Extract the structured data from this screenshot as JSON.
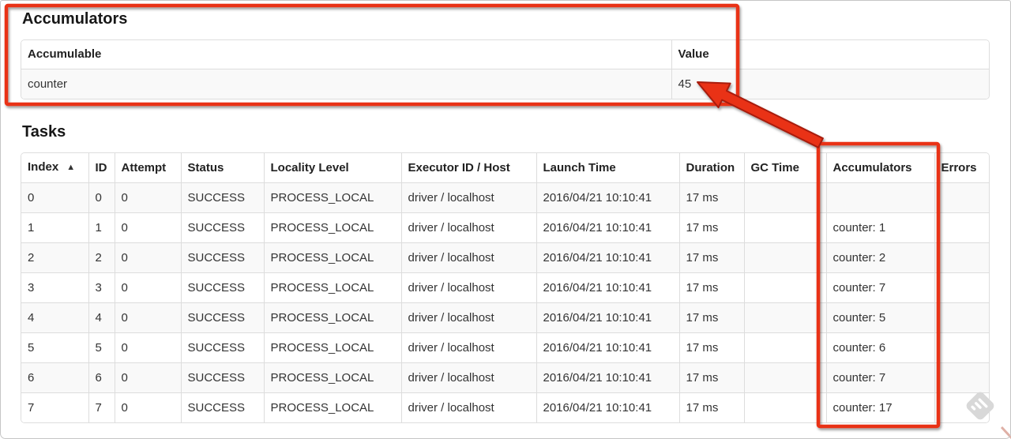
{
  "accumulators_section": {
    "title": "Accumulators",
    "columns": [
      "Accumulable",
      "Value"
    ],
    "rows": [
      {
        "accumulable": "counter",
        "value": "45"
      }
    ]
  },
  "tasks_section": {
    "title": "Tasks",
    "sort_icon": "▲",
    "sorted_column": "Index",
    "columns": [
      "Index",
      "ID",
      "Attempt",
      "Status",
      "Locality Level",
      "Executor ID / Host",
      "Launch Time",
      "Duration",
      "GC Time",
      "Accumulators",
      "Errors"
    ],
    "rows": [
      {
        "index": "0",
        "id": "0",
        "attempt": "0",
        "status": "SUCCESS",
        "locality_level": "PROCESS_LOCAL",
        "executor_id_host": "driver / localhost",
        "launch_time": "2016/04/21 10:10:41",
        "duration": "17 ms",
        "gc_time": "",
        "accumulators": "",
        "errors": ""
      },
      {
        "index": "1",
        "id": "1",
        "attempt": "0",
        "status": "SUCCESS",
        "locality_level": "PROCESS_LOCAL",
        "executor_id_host": "driver / localhost",
        "launch_time": "2016/04/21 10:10:41",
        "duration": "17 ms",
        "gc_time": "",
        "accumulators": "counter: 1",
        "errors": ""
      },
      {
        "index": "2",
        "id": "2",
        "attempt": "0",
        "status": "SUCCESS",
        "locality_level": "PROCESS_LOCAL",
        "executor_id_host": "driver / localhost",
        "launch_time": "2016/04/21 10:10:41",
        "duration": "17 ms",
        "gc_time": "",
        "accumulators": "counter: 2",
        "errors": ""
      },
      {
        "index": "3",
        "id": "3",
        "attempt": "0",
        "status": "SUCCESS",
        "locality_level": "PROCESS_LOCAL",
        "executor_id_host": "driver / localhost",
        "launch_time": "2016/04/21 10:10:41",
        "duration": "17 ms",
        "gc_time": "",
        "accumulators": "counter: 7",
        "errors": ""
      },
      {
        "index": "4",
        "id": "4",
        "attempt": "0",
        "status": "SUCCESS",
        "locality_level": "PROCESS_LOCAL",
        "executor_id_host": "driver / localhost",
        "launch_time": "2016/04/21 10:10:41",
        "duration": "17 ms",
        "gc_time": "",
        "accumulators": "counter: 5",
        "errors": ""
      },
      {
        "index": "5",
        "id": "5",
        "attempt": "0",
        "status": "SUCCESS",
        "locality_level": "PROCESS_LOCAL",
        "executor_id_host": "driver / localhost",
        "launch_time": "2016/04/21 10:10:41",
        "duration": "17 ms",
        "gc_time": "",
        "accumulators": "counter: 6",
        "errors": ""
      },
      {
        "index": "6",
        "id": "6",
        "attempt": "0",
        "status": "SUCCESS",
        "locality_level": "PROCESS_LOCAL",
        "executor_id_host": "driver / localhost",
        "launch_time": "2016/04/21 10:10:41",
        "duration": "17 ms",
        "gc_time": "",
        "accumulators": "counter: 7",
        "errors": ""
      },
      {
        "index": "7",
        "id": "7",
        "attempt": "0",
        "status": "SUCCESS",
        "locality_level": "PROCESS_LOCAL",
        "executor_id_host": "driver / localhost",
        "launch_time": "2016/04/21 10:10:41",
        "duration": "17 ms",
        "gc_time": "",
        "accumulators": "counter: 17",
        "errors": ""
      }
    ]
  },
  "annotation": {
    "color": "#e93118",
    "stroke": "#a81c0a",
    "watermark_color": "#d8d8d8",
    "corner_mark_color": "#dfb0a6"
  }
}
